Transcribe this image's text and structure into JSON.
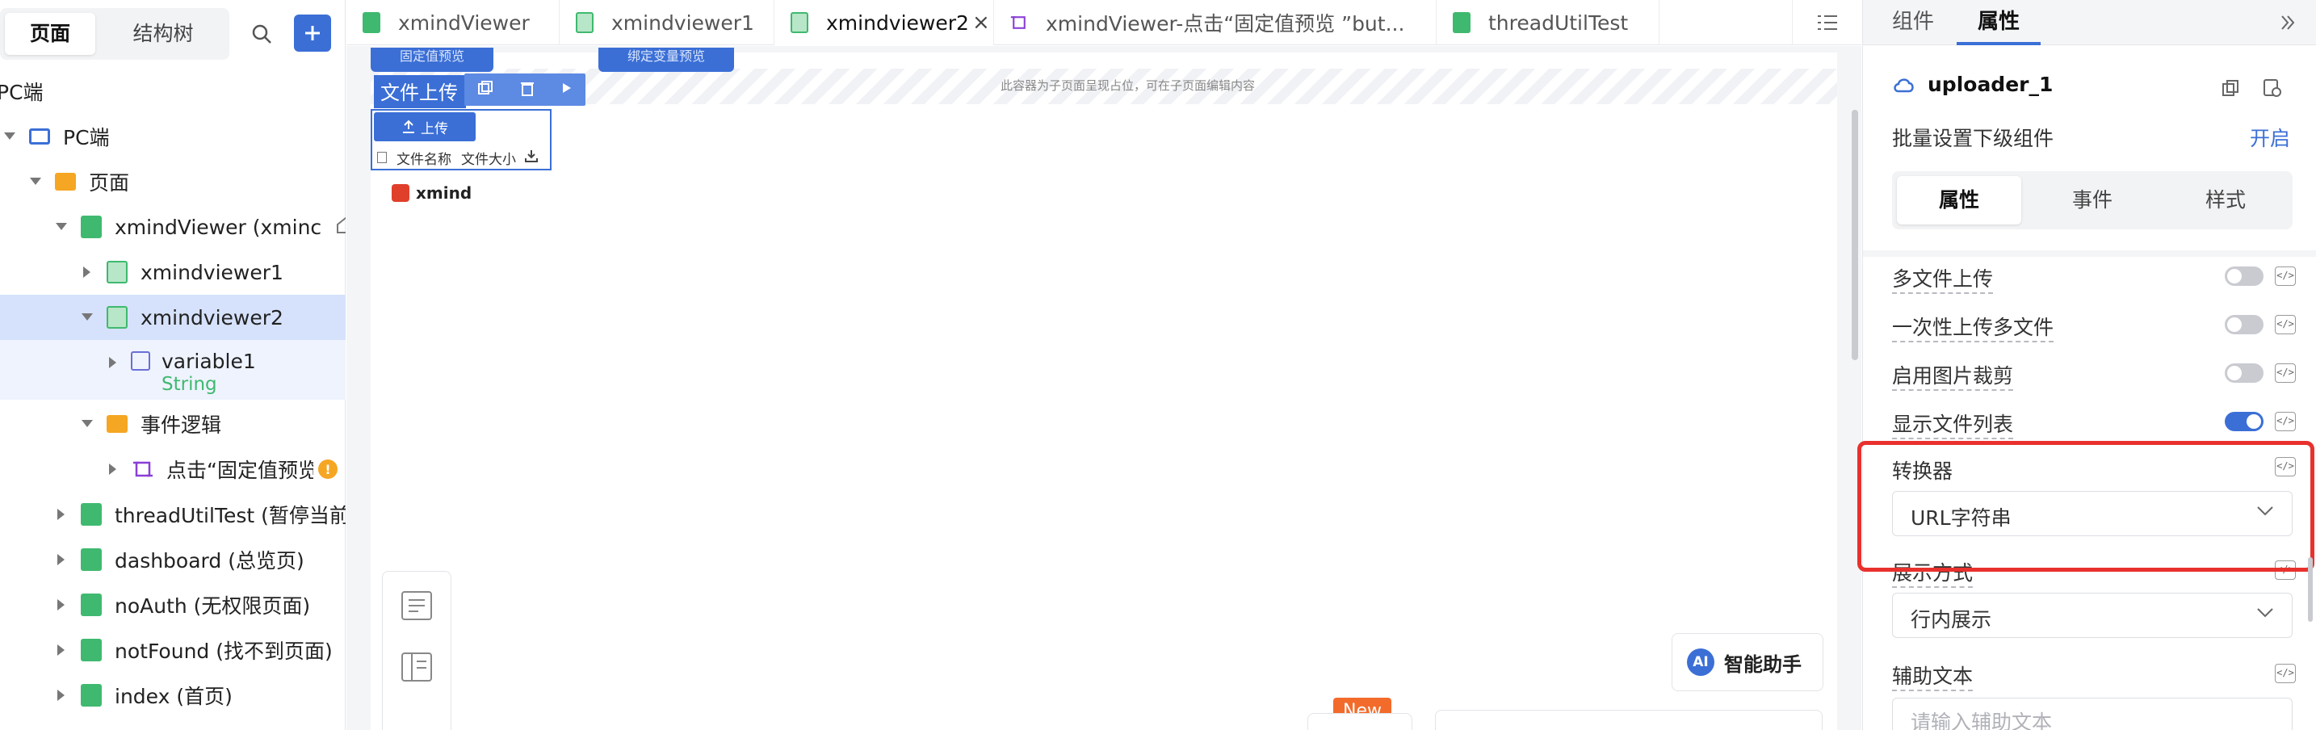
{
  "sidebar": {
    "tabs": [
      "页面",
      "结构树"
    ],
    "tree": {
      "root_partial": "PC端",
      "pc": "PC端",
      "pages_folder": "页面",
      "xmindviewer_main": "xmindViewer (xminc",
      "xmindviewer1": "xmindviewer1",
      "xmindviewer2": "xmindviewer2",
      "variable1": "variable1",
      "variable1_type": "String",
      "event_folder": "事件逻辑",
      "event_item": "点击“固定值预览",
      "thread_util": "threadUtilTest (暂停当前线",
      "dashboard": "dashboard (总览页)",
      "noauth": "noAuth (无权限页面)",
      "notfound": "notFound (找不到页面)",
      "index": "index (首页)"
    }
  },
  "tabs": {
    "t1": "xmindViewer",
    "t2": "xmindviewer1",
    "t3": "xmindviewer2",
    "t3_close": "×",
    "t4": "xmindViewer-点击“固定值预览 ”but...",
    "t5": "threadUtilTest"
  },
  "canvas": {
    "pill1": "固定值预览",
    "pill2": "绑定变量预览",
    "upload_label": "文件上传",
    "container_hint": "此容器为子页面呈现占位，可在子页面编辑内容",
    "upload_button": "上传",
    "col_name": "文件名称",
    "col_size": "文件大小",
    "xmind_logo": "xmind",
    "ai_assistant": "智能助手",
    "ai_badge": "AI",
    "new_badge": "New"
  },
  "panel": {
    "tabs": [
      "组件",
      "属性"
    ],
    "component_name": "uploader_1",
    "batch_label": "批量设置下级组件",
    "batch_link": "开启",
    "sub_tabs": [
      "属性",
      "事件",
      "样式"
    ],
    "rows": {
      "multi_upload": "多文件上传",
      "once_multi": "一次性上传多文件",
      "image_crop": "启用图片裁剪",
      "show_list": "显示文件列表",
      "converter": "转换器",
      "display_mode": "展示方式",
      "helper_text": "辅助文本"
    },
    "toggles": {
      "multi_upload": false,
      "once_multi": false,
      "image_crop": false,
      "show_list": true
    },
    "converter_value": "URL字符串",
    "display_value": "行内展示",
    "helper_placeholder": "请输入辅助文本"
  },
  "colors": {
    "accent": "#3b6fd6",
    "highlight": "#e8312d",
    "page_icon": "#3fb96f",
    "folder_icon": "#f5a623"
  }
}
